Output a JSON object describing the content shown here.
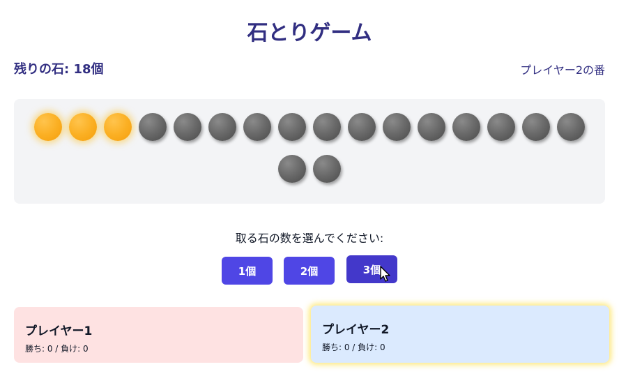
{
  "game": {
    "title": "石とりゲーム",
    "remaining_label": "残りの石: 18個",
    "turn_label": "プレイヤー2の番",
    "stones_total": 18,
    "stones_selected": 3,
    "prompt": "取る石の数を選んでください:",
    "take_buttons": [
      "1個",
      "2個",
      "3個"
    ]
  },
  "players": [
    {
      "name": "プレイヤー1",
      "stats": "勝ち: 0 / 負け: 0",
      "color": "#fee2e2"
    },
    {
      "name": "プレイヤー2",
      "stats": "勝ち: 0 / 負け: 0",
      "color": "#dbeafe",
      "active": true
    }
  ],
  "colors": {
    "accent": "#4f46e5",
    "title": "#312e81",
    "stone": "#6b6b6b",
    "stone_selected": "#fbb024"
  }
}
